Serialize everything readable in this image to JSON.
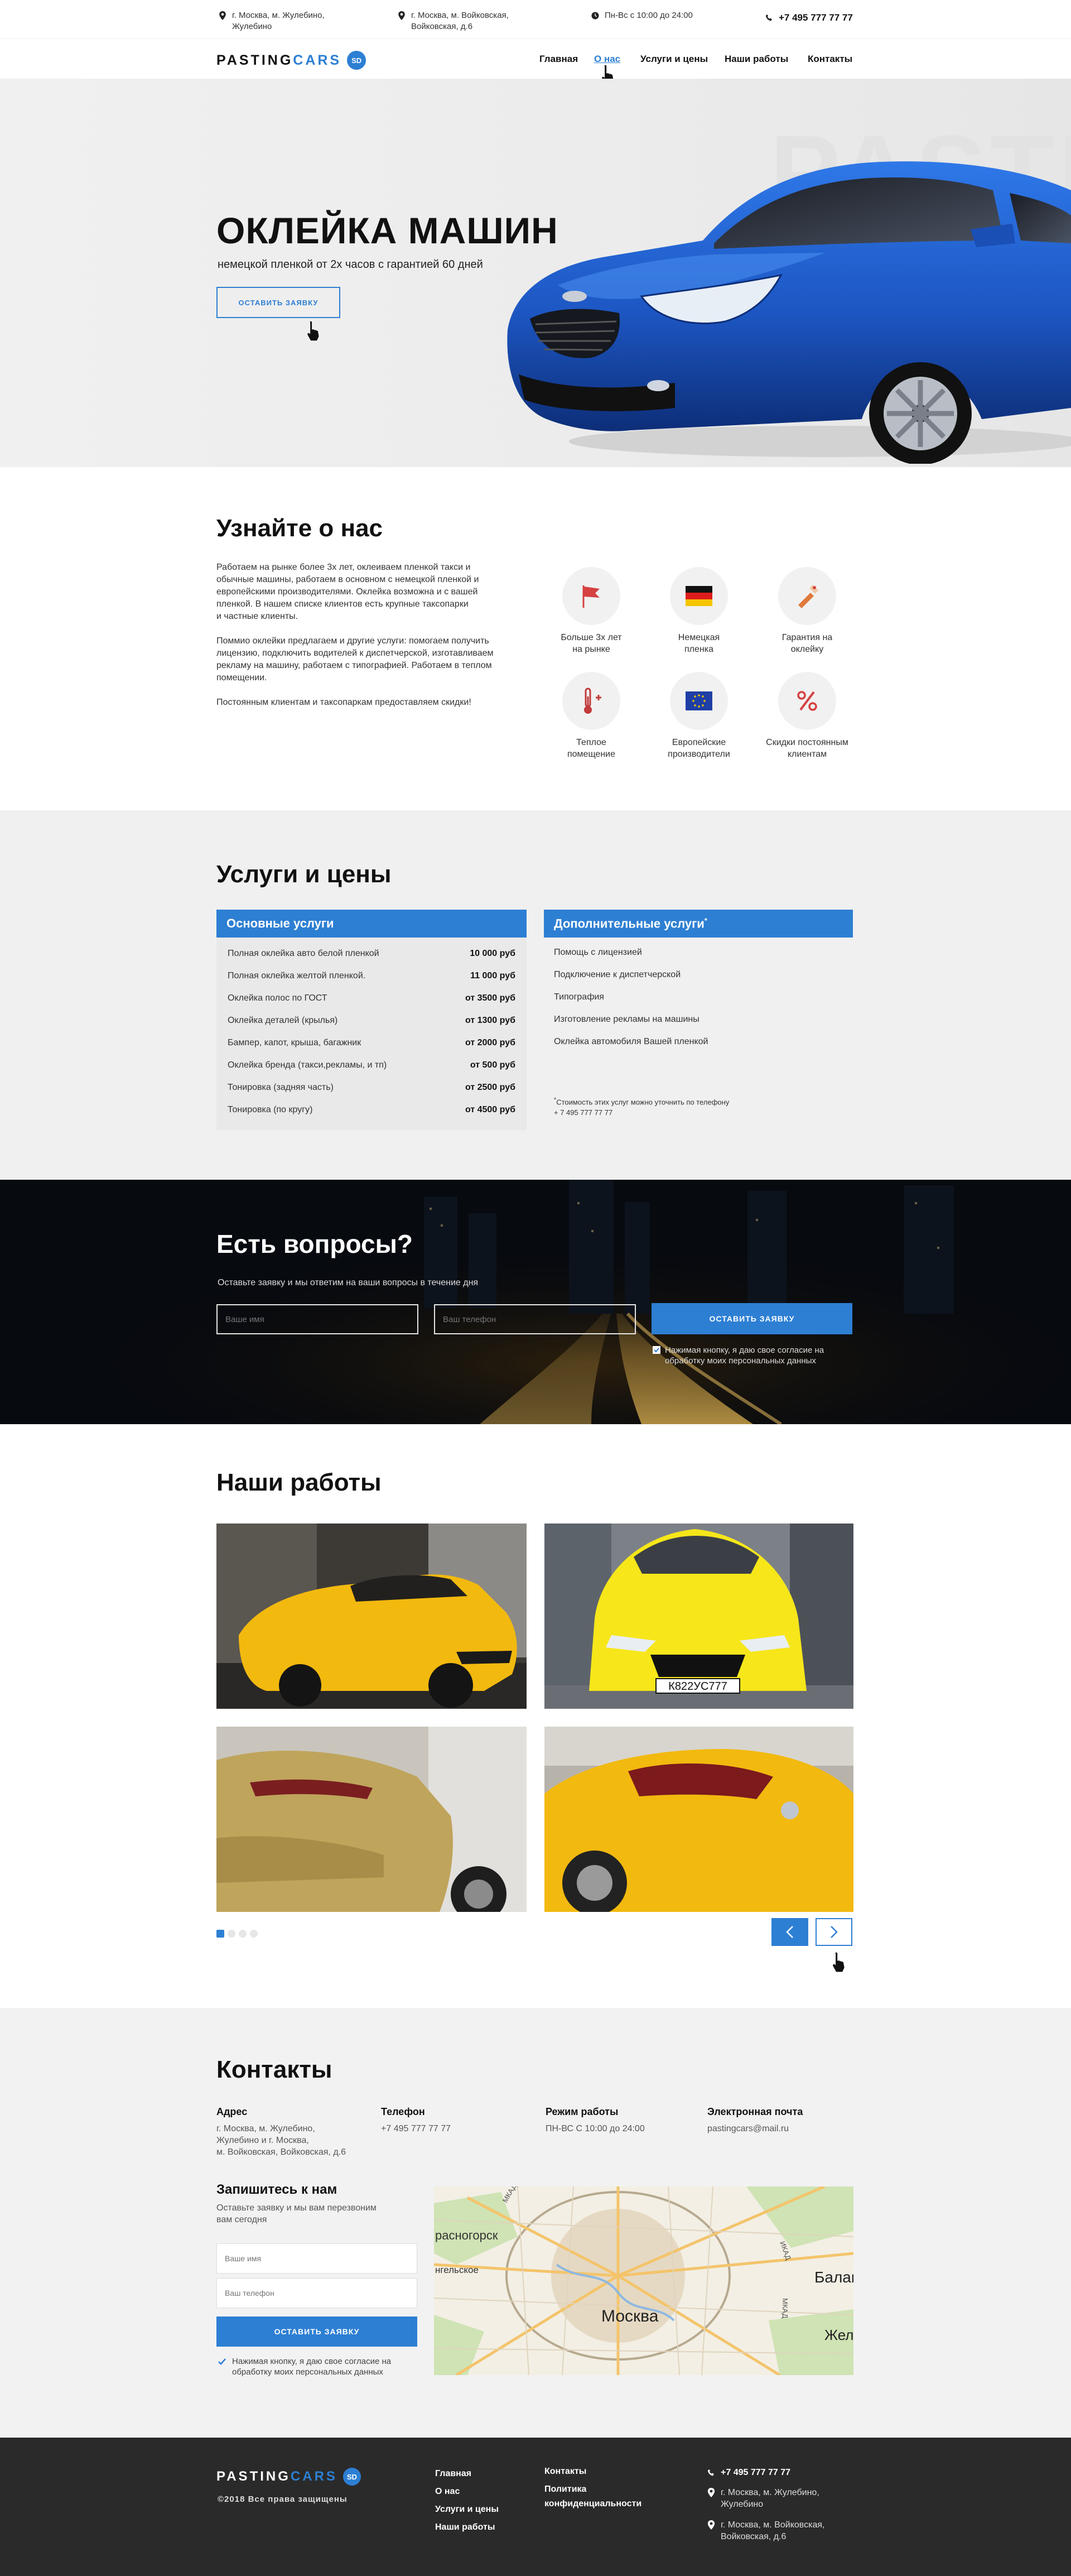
{
  "topbar": {
    "address1": [
      "г. Москва, м. Жулебино,",
      "Жулебино"
    ],
    "address2": [
      "г. Москва, м. Войковская,",
      "Войковская, д.6"
    ],
    "hours": "Пн-Вс с 10:00 до 24:00",
    "phone": "+7 495 777 77 77"
  },
  "logo": {
    "part1": "PASTING",
    "part2": "CARS",
    "badge": "SD"
  },
  "nav": [
    "Главная",
    "О нас",
    "Услуги и цены",
    "Наши работы",
    "Контакты"
  ],
  "nav_active": "О нас",
  "hero": {
    "bg_text": "PASTING",
    "title": "ОКЛЕЙКА МАШИН",
    "subtitle": "немецкой пленкой от 2х часов с гарантией 60 дней",
    "button": "оставить заявку",
    "car_color": "#1d57c4"
  },
  "about": {
    "title": "Узнайте о нас",
    "paragraphs": [
      [
        "Работаем на рынке более 3х лет, оклеиваем пленкой такси и",
        "обычные машины, работаем в основном с немецкой пленкой  и",
        "европейскими производителями. Оклейка возможна и с вашей",
        "пленкой. В нашем списке клиентов есть крупные таксопарки",
        "и частные клиенты."
      ],
      [
        "Поммио оклейки предлагаем и другие услуги: помогаем получить",
        "лицензию, подключить водителей к диспетчерской, изготавливаем",
        "рекламу на машину, работаем с типографией. Работаем в теплом",
        "помещении."
      ],
      [
        "Постоянным клиентам и таксопаркам предоставляем скидки!"
      ]
    ],
    "features": [
      {
        "icon": "flag-icon",
        "label": [
          "Больше 3х лет",
          "на рынке"
        ]
      },
      {
        "icon": "germany-flag-icon",
        "label": [
          "Немецкая",
          "пленка"
        ]
      },
      {
        "icon": "warranty-icon",
        "label": [
          "Гарантия на",
          "оклейку"
        ]
      },
      {
        "icon": "thermometer-icon",
        "label": [
          "Теплое",
          "помещение"
        ]
      },
      {
        "icon": "eu-flag-icon",
        "label": [
          "Европейские",
          "производители"
        ]
      },
      {
        "icon": "percent-icon",
        "label": [
          "Скидки постоянным",
          "клиентам"
        ]
      }
    ]
  },
  "services": {
    "title": "Услуги и цены",
    "main_head": "Основные услуги",
    "main": [
      {
        "name": "Полная оклейка авто белой пленкой",
        "price": "10 000 руб"
      },
      {
        "name": "Полная оклейка желтой пленкой.",
        "price": "11 000 руб"
      },
      {
        "name": "Оклейка полос по ГОСТ",
        "price": "от 3500 руб"
      },
      {
        "name": "Оклейка деталей (крылья)",
        "price": "от 1300 руб"
      },
      {
        "name": "Бампер, капот, крыша, багажник",
        "price": "от 2000 руб"
      },
      {
        "name": "Оклейка бренда (такси,рекламы, и тп)",
        "price": "от 500 руб"
      },
      {
        "name": "Тонировка (задняя часть)",
        "price": "от 2500 руб"
      },
      {
        "name": "Тонировка (по кругу)",
        "price": "от 4500 руб"
      }
    ],
    "extra_head": "Дополнительные услуги",
    "extra_head_mark": "*",
    "extra": [
      "Помощь с лицензией",
      "Подключение к диспетчерской",
      "Типография",
      "Изготовление рекламы на машины",
      "Оклейка автомобиля Вашей пленкой"
    ],
    "note_mark": "*",
    "note": [
      "Стоимость этих услуг можно уточнить по телефону",
      "+ 7 495 777 77 77"
    ]
  },
  "questions": {
    "title": "Есть вопросы?",
    "subtitle": "Оставьте заявку и мы ответим на ваши вопросы в течение дня",
    "name_placeholder": "Ваше имя",
    "phone_placeholder": "Ваш телефон",
    "button": "оставить заявку",
    "consent": [
      "Нажимая кнопку, я даю свое согласие на",
      "обработку моих персональных данных"
    ]
  },
  "works": {
    "title": "Наши работы",
    "plate": "К822УС777",
    "slides": 4,
    "active_slide": 1
  },
  "contacts": {
    "title": "Контакты",
    "address_head": "Адрес",
    "address": [
      "г. Москва, м. Жулебино,",
      "Жулебино и г. Москва,",
      "м. Войковская, Войковская, д.6"
    ],
    "phone_head": "Телефон",
    "phone": "+7 495 777 77 77",
    "hours_head": "Режим работы",
    "hours": "ПН-ВС С 10:00 до 24:00",
    "email_head": "Электронная почта",
    "email": "pastingcars@mail.ru",
    "signup_title": "Запишитесь к нам",
    "signup_text": [
      "Оставьте заявку и мы вам перезвоним",
      "вам сегодня"
    ],
    "name_placeholder": "Ваше имя",
    "phone_placeholder": "Ваш телефон",
    "button": "оставить заявку",
    "consent": [
      "Нажимая кнопку, я даю свое согласие на",
      "обработку моих персональных данных"
    ],
    "map_labels": [
      "расногорск",
      "нгельское",
      "Москва",
      "МКАД",
      "Балаш",
      "Желе",
      "ИКАД",
      "МКАД"
    ]
  },
  "footer": {
    "copyright": "©2018 Все права защищены",
    "links1": [
      "Главная",
      "О нас",
      "Услуги и цены",
      "Наши работы"
    ],
    "links2": [
      "Контакты",
      "Политика",
      "конфиденциальности"
    ],
    "phone": "+7 495 777 77 77",
    "address1": [
      "г. Москва, м. Жулебино,",
      "Жулебино"
    ],
    "address2": [
      "г. Москва, м. Войковская,",
      "Войковская, д.6"
    ]
  },
  "colors": {
    "accent": "#2d7fd3",
    "dark": "#2a2a2a",
    "light": "#f0f0f0",
    "taxi_yellow": "#f2b90f"
  }
}
